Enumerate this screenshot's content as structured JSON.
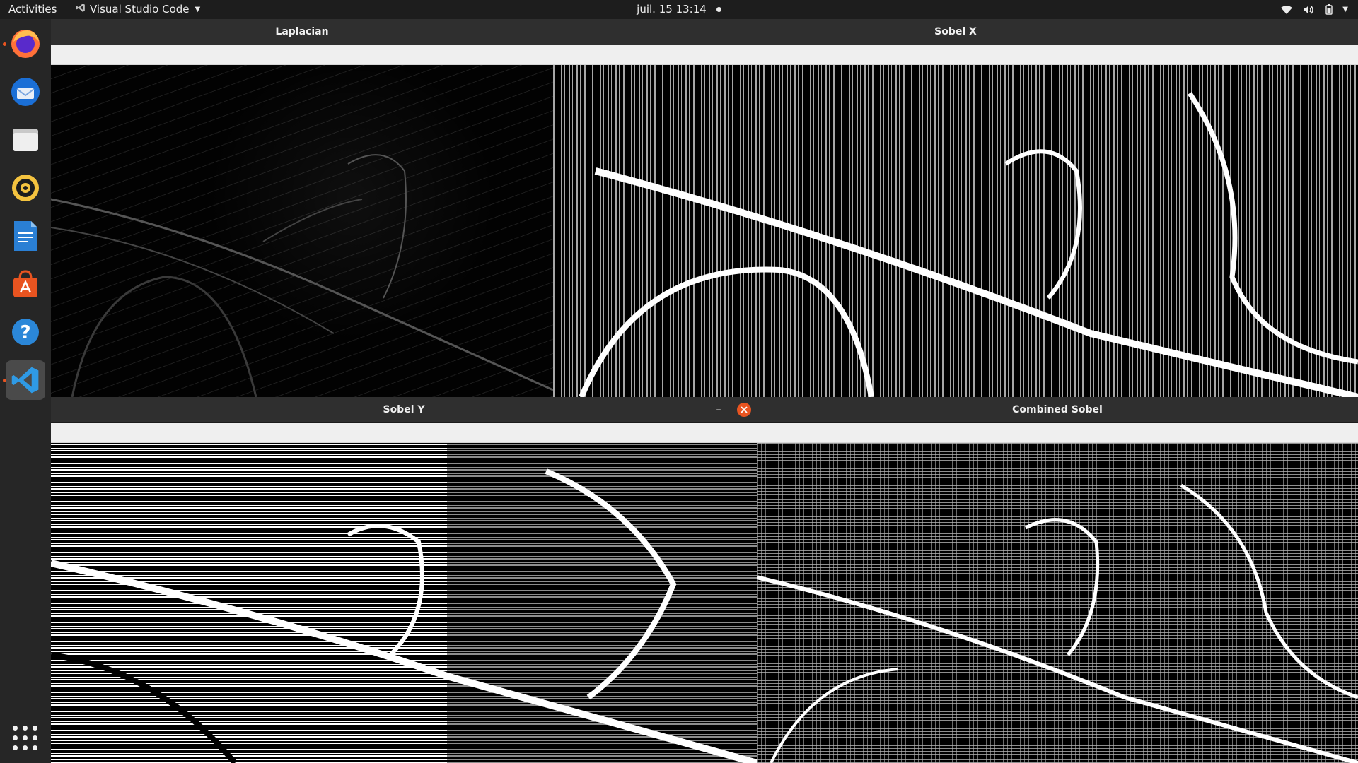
{
  "topbar": {
    "activities": "Activities",
    "app_name": "Visual Studio Code",
    "clock": "juil. 15  13:14"
  },
  "dock": {
    "items": [
      {
        "name": "firefox-icon",
        "running": true
      },
      {
        "name": "thunderbird-icon"
      },
      {
        "name": "files-icon"
      },
      {
        "name": "rhythmbox-icon"
      },
      {
        "name": "libreoffice-writer-icon"
      },
      {
        "name": "ubuntu-software-icon"
      },
      {
        "name": "help-icon"
      },
      {
        "name": "vscode-icon",
        "running": true,
        "active": true
      }
    ]
  },
  "windows": {
    "laplacian": {
      "title": "Laplacian"
    },
    "sobel_x": {
      "title": "Sobel X"
    },
    "sobel_y": {
      "title": "Sobel Y"
    },
    "combined": {
      "title": "Combined Sobel"
    }
  },
  "colors": {
    "accent": "#e95420",
    "topbar": "#1d1d1d",
    "titlebar": "#2f2f2f",
    "toolbar": "#efefef"
  }
}
